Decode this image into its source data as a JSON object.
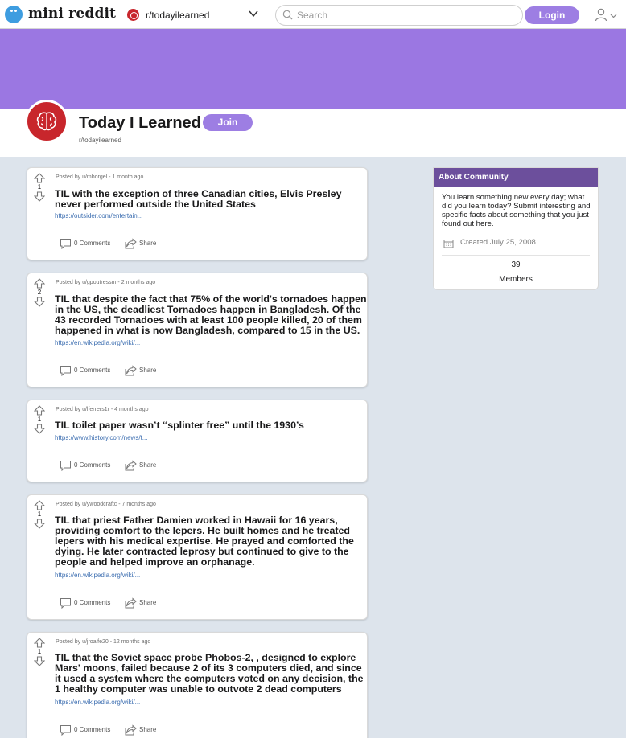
{
  "header": {
    "logo_text": "mini reddit",
    "subreddit_selector": "r/todayilearned",
    "search_placeholder": "Search",
    "login_label": "Login"
  },
  "subreddit": {
    "title": "Today I Learned",
    "handle": "r/todayilearned",
    "join_label": "Join"
  },
  "posts": [
    {
      "votes": "1",
      "meta": "Posted by u/mborgel - 1 month ago",
      "title": "TIL with the exception of three Canadian cities, Elvis Presley never performed outside the United States",
      "link": "https://outsider.com/entertain...",
      "comments": "0 Comments",
      "share": "Share"
    },
    {
      "votes": "2",
      "meta": "Posted by u/gpoutressm - 2 months ago",
      "title": "TIL that despite the fact that 75% of the world's tornadoes happen in the US, the deadliest Tornadoes happen in Bangladesh. Of the 43 recorded Tornadoes with at least 100 people killed, 20 of them happened in what is now Bangladesh, compared to 15 in the US.",
      "link": "https://en.wikipedia.org/wiki/...",
      "comments": "0 Comments",
      "share": "Share"
    },
    {
      "votes": "1",
      "meta": "Posted by u/lferrers1r - 4 months ago",
      "title": "TIL toilet paper wasn’t “splinter free” until the 1930’s",
      "link": "https://www.history.com/news/t...",
      "comments": "0 Comments",
      "share": "Share"
    },
    {
      "votes": "1",
      "meta": "Posted by u/ywoodcraftc - 7 months ago",
      "title": "TIL that priest Father Damien worked in Hawaii for 16 years, providing comfort to the lepers. He built homes and he treated lepers with his medical expertise. He prayed and comforted the dying. He later contracted leprosy but continued to give to the people and helped improve an orphanage.",
      "link": "https://en.wikipedia.org/wiki/...",
      "comments": "0 Comments",
      "share": "Share"
    },
    {
      "votes": "1",
      "meta": "Posted by u/jroalfe20 - 12 months ago",
      "title": "TIL that the Soviet space probe Phobos-2, , designed to explore Mars' moons, failed because 2 of its 3 computers died, and since it used a system where the computers voted on any decision, the 1 healthy computer was unable to outvote 2 dead computers",
      "link": "https://en.wikipedia.org/wiki/...",
      "comments": "0 Comments",
      "share": "Share"
    }
  ],
  "about": {
    "heading": "About Community",
    "description": "You learn something new every day; what did you learn today? Submit interesting and specific facts about something that you just found out here.",
    "created": "Created July 25, 2008",
    "members_count": "39",
    "members_label": "Members"
  },
  "colors": {
    "accent": "#9d7ee3",
    "banner": "#9b77e2",
    "about_header": "#6c4f9c",
    "subreddit_icon": "#c8262c"
  }
}
